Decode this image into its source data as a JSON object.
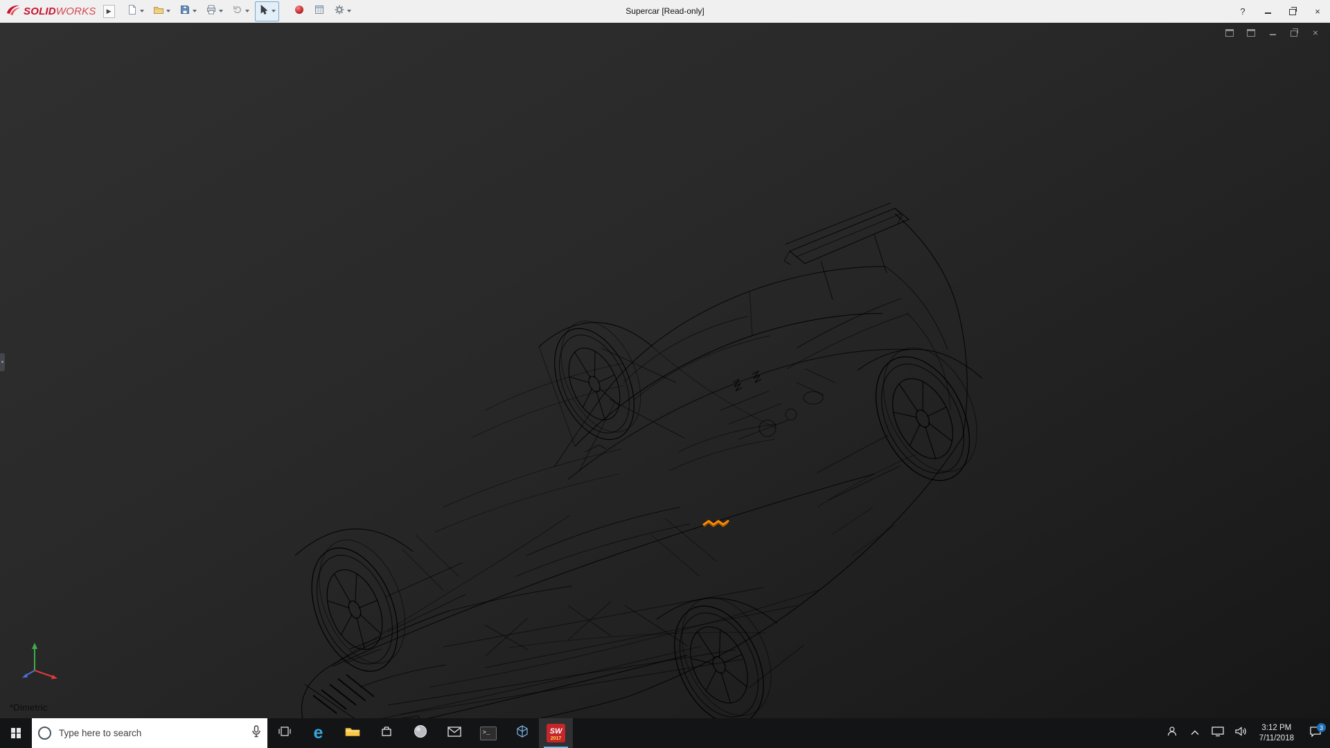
{
  "titlebar": {
    "brand_solid": "SOLID",
    "brand_works": "WORKS",
    "brand_color": "#c8102e",
    "expand_glyph": "▶",
    "title": "Supercar [Read-only]",
    "help_glyph": "?",
    "close_glyph": "×"
  },
  "toolbar": {
    "tools": [
      "new-document",
      "open",
      "save",
      "print",
      "undo",
      "select",
      "edit-appearance",
      "design-table",
      "options"
    ],
    "active_tool": "select"
  },
  "viewport": {
    "view_label": "*Dimetric",
    "highlight_color": "#ff8a00",
    "doc_close_glyph": "×",
    "background_top": "#303030",
    "background_bottom": "#171717"
  },
  "taskbar": {
    "search_placeholder": "Type here to search",
    "edge_glyph": "e",
    "terminal_glyph": ">_",
    "sw_label": "SW",
    "sw_year": "2017",
    "clock_time": "3:12 PM",
    "clock_date": "7/11/2018",
    "action_badge": "3",
    "active_indicator_color": "#76b9ed"
  }
}
